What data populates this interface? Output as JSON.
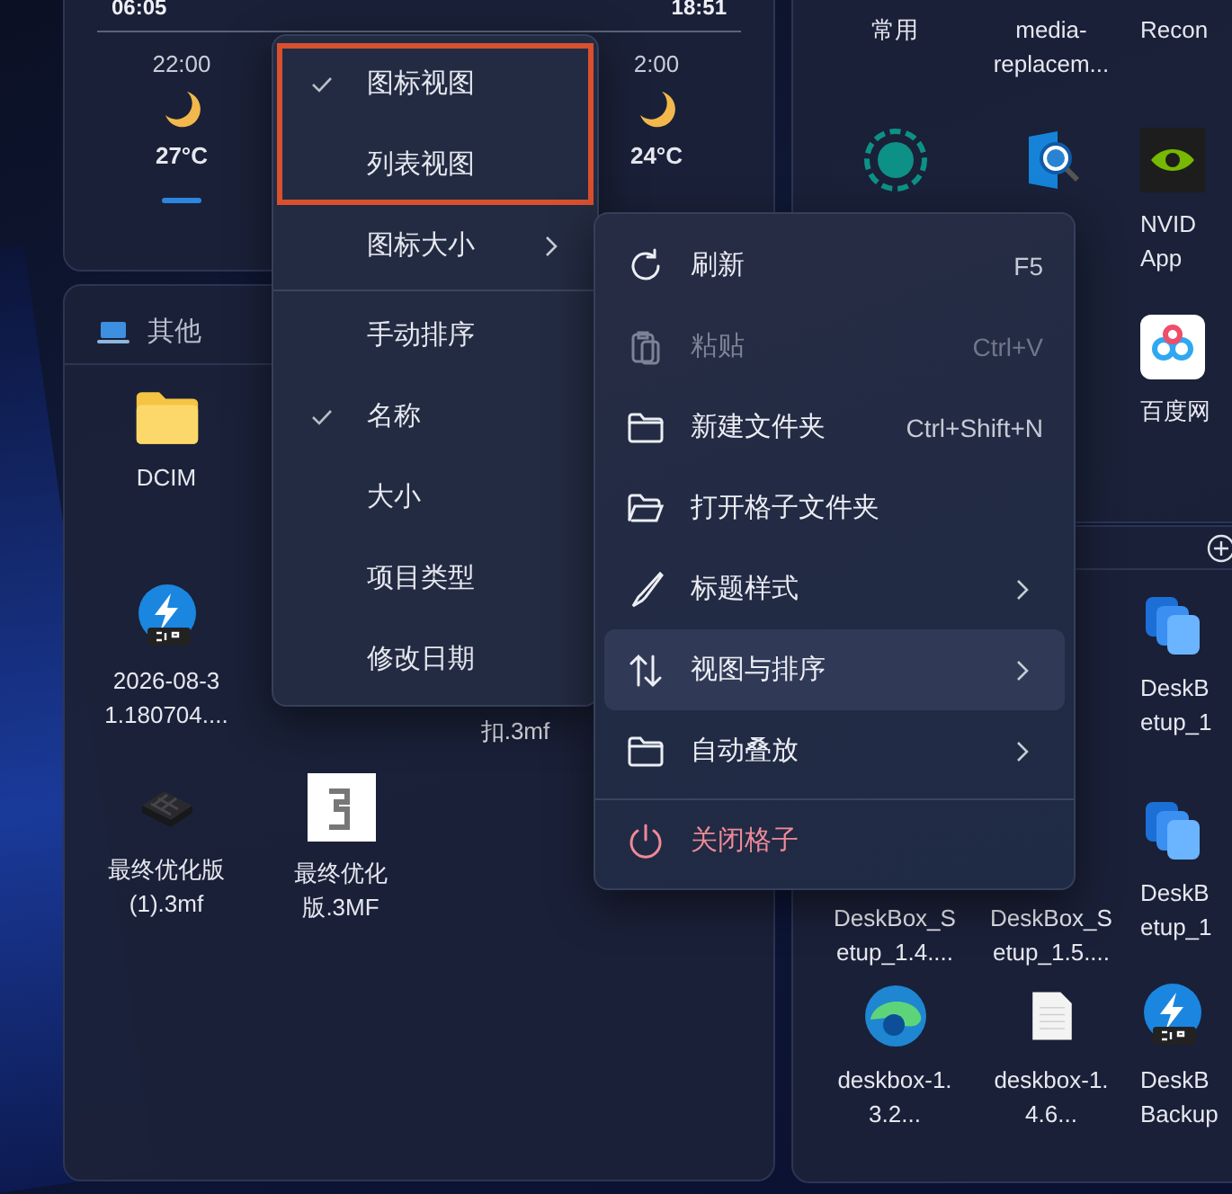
{
  "weather": {
    "sunrise": "06:05",
    "sunset": "18:51",
    "hours": [
      {
        "time": "22:00",
        "temp": "27°C",
        "selected": true
      },
      {
        "time": "2:00",
        "temp": "24°C",
        "selected": false
      }
    ]
  },
  "left_box": {
    "tabs": [
      {
        "label": "其他",
        "selected": false
      }
    ],
    "items": [
      {
        "kind": "folder",
        "label_lines": [
          "DCIM"
        ]
      },
      {
        "kind": "zip",
        "label_lines": [
          "2026-08-3",
          "1.180704...."
        ]
      },
      {
        "label_lines": [
          "扣.3mf"
        ]
      },
      {
        "kind": "model",
        "label_lines": [
          "最终优化版",
          "(1).3mf"
        ]
      },
      {
        "kind": "thumbnail",
        "label_lines": [
          "最终优化",
          "版.3MF"
        ]
      }
    ]
  },
  "right_top_box": {
    "items": [
      {
        "label_lines": [
          "常用"
        ]
      },
      {
        "label_lines": [
          "media-",
          "replacem..."
        ]
      },
      {
        "label_lines": [
          "Recon"
        ]
      },
      {
        "kind": "dotted-circle"
      },
      {
        "kind": "magnifier"
      },
      {
        "kind": "green-eye",
        "label_lines": [
          "NVID",
          "App"
        ]
      },
      {
        "kind": "cloud",
        "label_lines": [
          "百度网"
        ]
      }
    ]
  },
  "right_bottom_box": {
    "items": [
      {
        "kind": "stack",
        "label_lines": [
          "DeskB",
          "etup_1"
        ]
      },
      {
        "label_lines": [
          "DeskBox_S",
          "etup_1.4...."
        ]
      },
      {
        "label_lines": [
          "DeskBox_S",
          "etup_1.5...."
        ]
      },
      {
        "kind": "stack",
        "label_lines": [
          "DeskB",
          "etup_1"
        ]
      },
      {
        "kind": "swirl",
        "label_lines": [
          "deskbox-1.",
          "3.2..."
        ]
      },
      {
        "kind": "document",
        "label_lines": [
          "deskbox-1.",
          "4.6..."
        ]
      },
      {
        "kind": "zip",
        "label_lines": [
          "DeskB",
          "Backup"
        ]
      }
    ]
  },
  "view_menu": {
    "groups": [
      {
        "highlighted": true,
        "divider_above": false,
        "items": [
          {
            "label": "图标视图",
            "checked": true,
            "submenu": false
          },
          {
            "label": "列表视图",
            "checked": false,
            "submenu": false
          }
        ]
      },
      {
        "highlighted": false,
        "divider_above": false,
        "items": [
          {
            "label": "图标大小",
            "checked": false,
            "submenu": true
          }
        ]
      },
      {
        "highlighted": false,
        "divider_above": true,
        "items": [
          {
            "label": "手动排序",
            "checked": false,
            "submenu": false
          },
          {
            "label": "名称",
            "checked": true,
            "submenu": false
          },
          {
            "label": "大小",
            "checked": false,
            "submenu": false
          },
          {
            "label": "项目类型",
            "checked": false,
            "submenu": false
          },
          {
            "label": "修改日期",
            "checked": false,
            "submenu": false
          }
        ]
      }
    ]
  },
  "context_menu": {
    "items": [
      {
        "kind": "refresh",
        "label": "刷新",
        "shortcut": "F5",
        "submenu": false,
        "disabled": false,
        "selected": false,
        "danger": false,
        "divider_above": false
      },
      {
        "kind": "paste",
        "label": "粘贴",
        "shortcut": "Ctrl+V",
        "submenu": false,
        "disabled": true,
        "selected": false,
        "danger": false,
        "divider_above": false
      },
      {
        "kind": "folder",
        "label": "新建文件夹",
        "shortcut": "Ctrl+Shift+N",
        "submenu": false,
        "disabled": false,
        "selected": false,
        "danger": false,
        "divider_above": false
      },
      {
        "kind": "folder-open",
        "label": "打开格子文件夹",
        "submenu": false,
        "disabled": false,
        "selected": false,
        "danger": false,
        "divider_above": false
      },
      {
        "kind": "brush",
        "label": "标题样式",
        "submenu": true,
        "disabled": false,
        "selected": false,
        "danger": false,
        "divider_above": false
      },
      {
        "kind": "sort",
        "label": "视图与排序",
        "submenu": true,
        "disabled": false,
        "selected": true,
        "danger": false,
        "divider_above": false
      },
      {
        "kind": "folder",
        "label": "自动叠放",
        "submenu": true,
        "disabled": false,
        "selected": false,
        "danger": false,
        "divider_above": false
      },
      {
        "kind": "power",
        "label": "关闭格子",
        "submenu": false,
        "disabled": false,
        "selected": false,
        "danger": true,
        "divider_above": true
      }
    ]
  }
}
